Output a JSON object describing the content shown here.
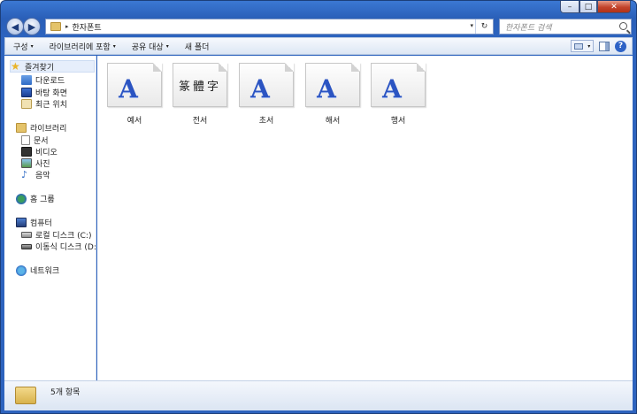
{
  "window": {
    "caption": {
      "minimize": "–",
      "maximize": "□",
      "close": "✕"
    }
  },
  "address": {
    "breadcrumb": "한자폰트",
    "crumb_separator": "▸",
    "dropdown": "▾",
    "refresh": "↻"
  },
  "search": {
    "placeholder": "한자폰트 검색"
  },
  "toolbar": {
    "items": [
      {
        "label": "구성",
        "dropdown": true
      },
      {
        "label": "라이브러리에 포함",
        "dropdown": true
      },
      {
        "label": "공유 대상",
        "dropdown": true
      },
      {
        "label": "새 폴더",
        "dropdown": false
      }
    ],
    "dropdown_glyph": "▾",
    "help_glyph": "?"
  },
  "nav": {
    "favorites": {
      "label": "즐겨찾기",
      "items": [
        "다운로드",
        "바탕 화면",
        "최근 위치"
      ]
    },
    "libraries": {
      "label": "라이브러리",
      "items": [
        "문서",
        "비디오",
        "사진",
        "음악"
      ]
    },
    "homegroup": {
      "label": "홈 그룹"
    },
    "computer": {
      "label": "컴퓨터",
      "items": [
        "로컬 디스크 (C:)",
        "이동식 디스크 (D:)"
      ]
    },
    "network": {
      "label": "네트워크"
    }
  },
  "files": [
    {
      "name": "예서",
      "preview": "A",
      "icon": "font-file-icon"
    },
    {
      "name": "전서",
      "preview": "篆體字",
      "icon": "font-file-icon"
    },
    {
      "name": "초서",
      "preview": "A",
      "icon": "font-file-icon"
    },
    {
      "name": "해서",
      "preview": "A",
      "icon": "font-file-icon"
    },
    {
      "name": "행서",
      "preview": "A",
      "icon": "font-file-icon"
    }
  ],
  "status": {
    "text": "5개 항목"
  },
  "colors": {
    "accent": "#2b54c2",
    "frame": "#2d63be",
    "close": "#c3432b"
  }
}
